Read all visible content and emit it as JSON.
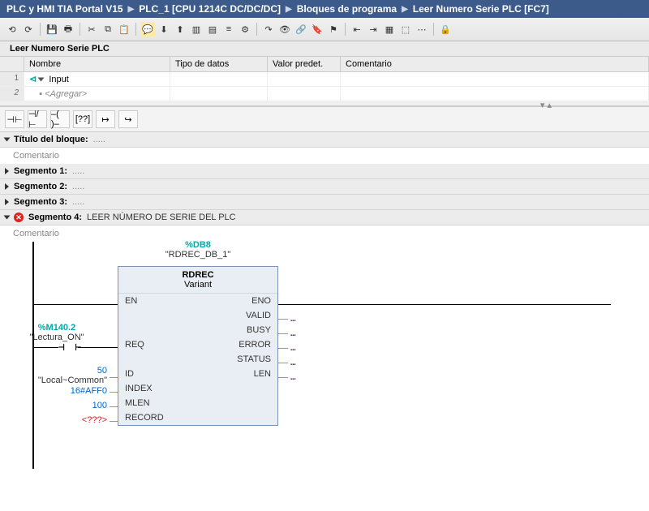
{
  "breadcrumb": [
    "PLC y HMI TIA Portal V15",
    "PLC_1 [CPU 1214C DC/DC/DC]",
    "Bloques de programa",
    "Leer Numero Serie PLC [FC7]"
  ],
  "block_title": "Leer Numero Serie PLC",
  "table": {
    "headers": [
      "",
      "Nombre",
      "Tipo de datos",
      "Valor predet.",
      "Comentario"
    ],
    "rows": [
      {
        "num": "1",
        "name": "Input",
        "is_group": true
      },
      {
        "num": "2",
        "name": "<Agregar>",
        "is_placeholder": true
      }
    ]
  },
  "section_header": {
    "label": "Título del bloque:",
    "dots": "....."
  },
  "comment_placeholder": "Comentario",
  "segments": [
    {
      "label": "Segmento 1:",
      "dots": ".....",
      "open": false
    },
    {
      "label": "Segmento 2:",
      "dots": ".....",
      "open": false
    },
    {
      "label": "Segmento 3:",
      "dots": ".....",
      "open": false
    }
  ],
  "segment4": {
    "label": "Segmento 4:",
    "title": "LEER NÚMERO DE SERIE DEL PLC",
    "has_error": true
  },
  "fb": {
    "db_addr": "%DB8",
    "db_name": "\"RDREC_DB_1\"",
    "name": "RDREC",
    "variant": "Variant",
    "inputs": [
      "EN",
      "REQ",
      "ID",
      "INDEX",
      "MLEN",
      "RECORD"
    ],
    "outputs": [
      "ENO",
      "VALID",
      "BUSY",
      "ERROR",
      "STATUS",
      "LEN"
    ]
  },
  "req_tag": {
    "addr": "%M140.2",
    "name": "\"Lectura_ON\""
  },
  "input_vals": {
    "id": {
      "num": "50",
      "str": "\"Local~Common\""
    },
    "index": "16#AFF0",
    "mlen": "100",
    "record": "<???>"
  },
  "out_placeholder": "…",
  "chart_data": {
    "type": "table",
    "title": "RDREC function block I/O",
    "series": [
      {
        "name": "input",
        "pin": "EN",
        "value": "(power rail)"
      },
      {
        "name": "input",
        "pin": "REQ",
        "value": "%M140.2 \"Lectura_ON\" (NO contact)"
      },
      {
        "name": "input",
        "pin": "ID",
        "value": "50 \"Local~Common\""
      },
      {
        "name": "input",
        "pin": "INDEX",
        "value": "16#AFF0"
      },
      {
        "name": "input",
        "pin": "MLEN",
        "value": "100"
      },
      {
        "name": "input",
        "pin": "RECORD",
        "value": "<???>"
      },
      {
        "name": "output",
        "pin": "ENO",
        "value": "(rail)"
      },
      {
        "name": "output",
        "pin": "VALID",
        "value": "…"
      },
      {
        "name": "output",
        "pin": "BUSY",
        "value": "…"
      },
      {
        "name": "output",
        "pin": "ERROR",
        "value": "…"
      },
      {
        "name": "output",
        "pin": "STATUS",
        "value": "…"
      },
      {
        "name": "output",
        "pin": "LEN",
        "value": "…"
      }
    ]
  }
}
